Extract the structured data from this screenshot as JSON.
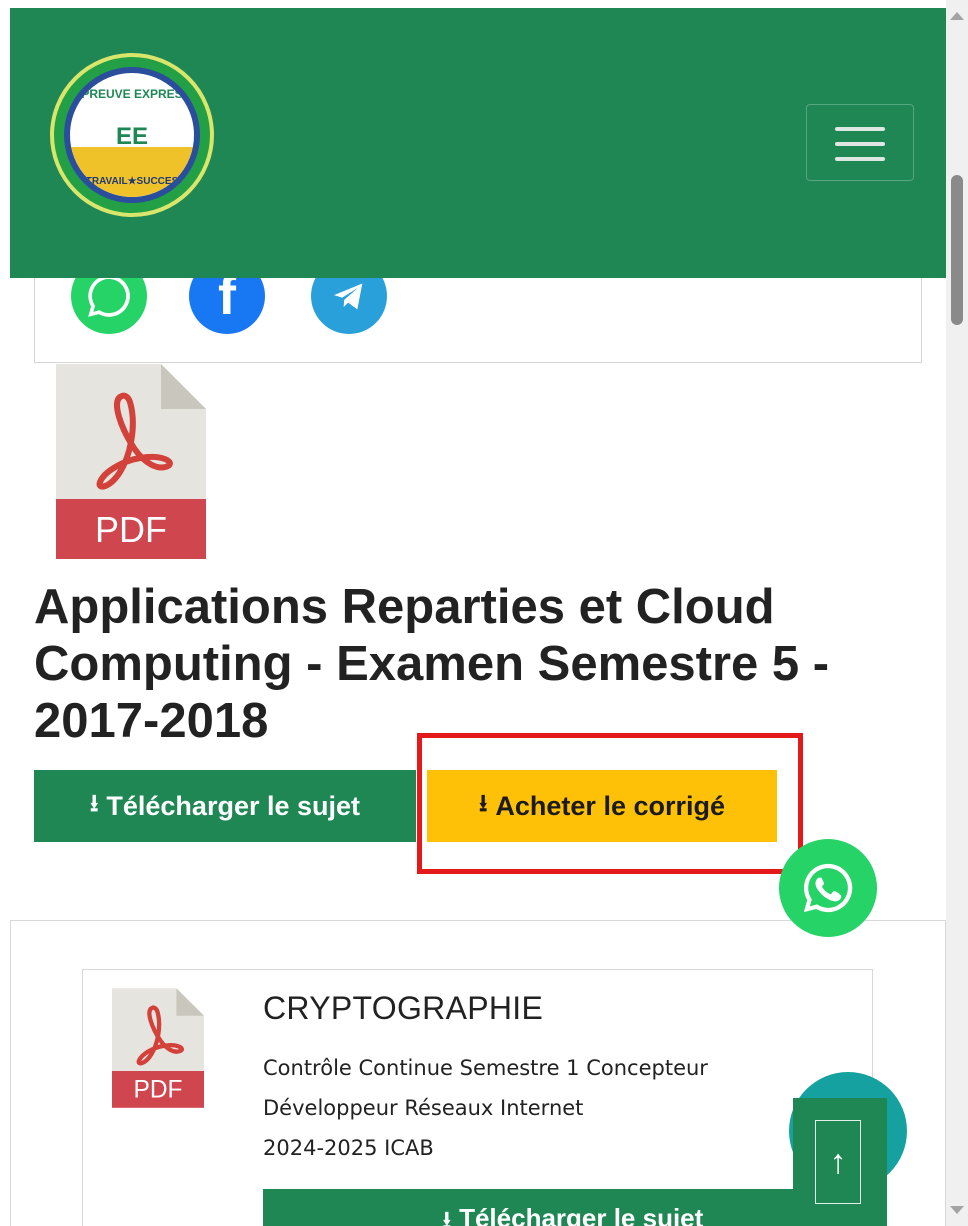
{
  "header": {
    "logo": {
      "top_text": "EPREUVE EXPRESS",
      "center_text": "EE",
      "bottom_text": "TRAVAIL★SUCCES"
    },
    "menu_icon": "hamburger-icon",
    "bg_color": "#1e8754"
  },
  "share": {
    "icons": [
      "whatsapp-icon",
      "facebook-icon",
      "telegram-icon"
    ]
  },
  "document": {
    "file_label": "PDF",
    "title": "Applications Reparties et Cloud Computing - Examen Semestre 5 - 2017-2018",
    "download_label": "Télécharger le sujet",
    "buy_label": "Acheter le corrigé"
  },
  "related": {
    "card": {
      "file_label": "PDF",
      "title": "CRYPTOGRAPHIE",
      "desc_line1": "Contrôle Continue Semestre 1 Concepteur",
      "desc_line2": "Développeur Réseaux Internet",
      "desc_line3": "2024-2025 ICAB",
      "download_label": "Télécharger le sujet"
    }
  },
  "floating": {
    "whatsapp": "whatsapp-icon",
    "back_to_top": "↑"
  },
  "colors": {
    "green": "#1e8754",
    "yellow": "#ffc107",
    "highlight": "#e41a1a",
    "whatsapp": "#25d366"
  }
}
